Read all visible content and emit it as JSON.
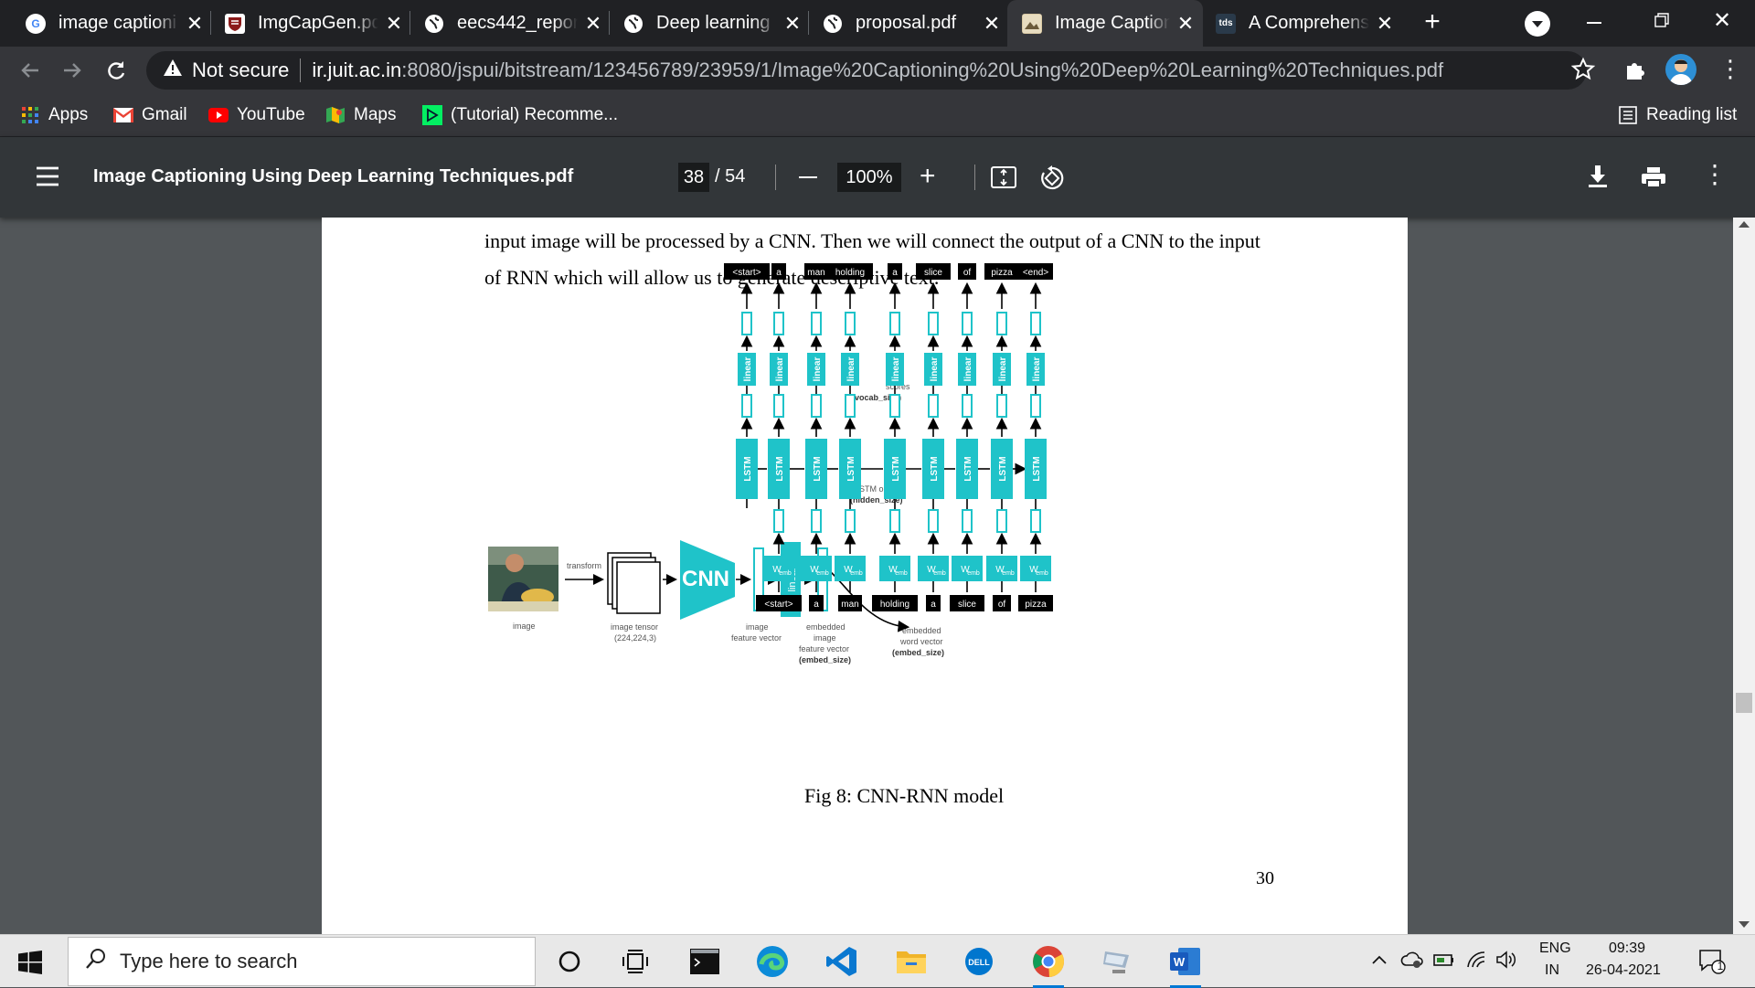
{
  "browser": {
    "tabs": [
      {
        "title": "image captioni",
        "icon": "google-icon"
      },
      {
        "title": "ImgCapGen.pd",
        "icon": "shield-crest-icon"
      },
      {
        "title": "eecs442_report",
        "icon": "globe-icon"
      },
      {
        "title": "Deep learning",
        "icon": "globe-icon"
      },
      {
        "title": "proposal.pdf",
        "icon": "globe-icon"
      },
      {
        "title": "Image Caption",
        "icon": "image-caption-site-icon",
        "active": true
      },
      {
        "title": "A Comprehens",
        "icon": "tds-icon"
      }
    ],
    "tds_badge": "tds",
    "security_label": "Not secure",
    "url_host": "ir.juit.ac.in",
    "url_rest": ":8080/jspui/bitstream/123456789/23959/1/Image%20Captioning%20Using%20Deep%20Learning%20Techniques.pdf",
    "bookmarks": [
      {
        "label": "Apps",
        "icon": "apps-grid-icon"
      },
      {
        "label": "Gmail",
        "icon": "gmail-icon"
      },
      {
        "label": "YouTube",
        "icon": "youtube-icon"
      },
      {
        "label": "Maps",
        "icon": "maps-icon"
      },
      {
        "label": "(Tutorial) Recomme...",
        "icon": "datacamp-icon"
      }
    ],
    "reading_list": "Reading list"
  },
  "pdf": {
    "filename": "Image Captioning Using Deep Learning Techniques.pdf",
    "current_page": "38",
    "total_pages": "/ 54",
    "zoom": "100%",
    "body_line1": "input image will be processed by a CNN. Then we will connect the output of a CNN to the input",
    "body_line2": "of RNN which will allow us to generate descriptive text.",
    "caption": "Fig 8: CNN-RNN model",
    "page_number": "30"
  },
  "diagram": {
    "output_tokens": [
      "<start>",
      "a",
      "man",
      "holding",
      "a",
      "slice",
      "of",
      "pizza",
      "<end>"
    ],
    "input_tokens": [
      "<start>",
      "a",
      "man",
      "holding",
      "a",
      "slice",
      "of",
      "pizza"
    ],
    "lstm_label": "LSTM",
    "linear_label": "linear",
    "cnn_label": "CNN",
    "wemb_label": "W",
    "wemb_sub": "emb",
    "labels": {
      "transform": "transform",
      "image": "image",
      "image_tensor": "image tensor",
      "image_tensor_dims": "(224,224,3)",
      "image_feature_1": "image",
      "image_feature_2": "feature vector",
      "embedded_image_1": "embedded",
      "embedded_image_2": "image",
      "embedded_image_3": "feature vector",
      "embedded_image_4": "(embed_size)",
      "embedded_word_1": "embedded",
      "embedded_word_2": "word vector",
      "embedded_word_3": "(embed_size)",
      "scores_1": "scores",
      "scores_2": "(vocab_size)",
      "lstm_out_1": "LSTM output",
      "lstm_out_2": "(hidden_size)"
    },
    "accent_color": "#1fc3c9"
  },
  "taskbar": {
    "search_placeholder": "Type here to search",
    "lang_1": "ENG",
    "lang_2": "IN",
    "time": "09:39",
    "date": "26-04-2021",
    "notification_count": "1",
    "apps": [
      "cortana-icon",
      "task-view-icon",
      "terminal-icon",
      "edge-icon",
      "vscode-icon",
      "file-explorer-icon",
      "dell-icon",
      "chrome-icon",
      "network-drive-icon",
      "word-icon"
    ]
  }
}
